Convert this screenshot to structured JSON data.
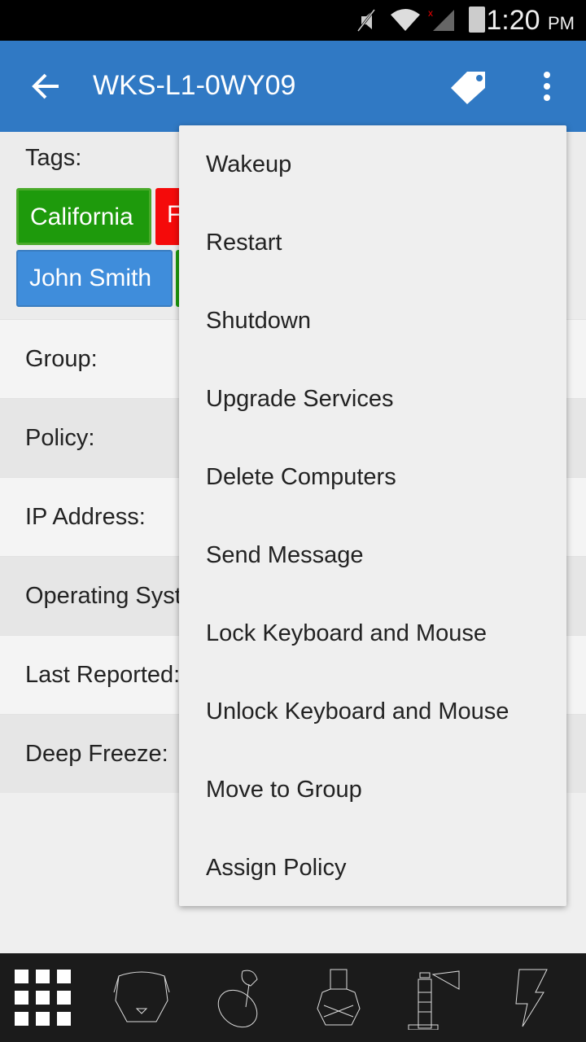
{
  "status_bar": {
    "time": "1:20",
    "ampm": "PM"
  },
  "app_bar": {
    "title": "WKS-L1-0WY09"
  },
  "tags": {
    "label": "Tags:",
    "items": [
      {
        "label": "California",
        "color": "#1e9a0c"
      },
      {
        "label": "F",
        "color": "#f50a0a"
      },
      {
        "label": "John Smith",
        "color": "#3f8ddb"
      },
      {
        "label": "",
        "color": "#1e9a0c"
      }
    ]
  },
  "fields": [
    {
      "label": "Group:"
    },
    {
      "label": "Policy:"
    },
    {
      "label": "IP Address:"
    },
    {
      "label": "Operating System:"
    },
    {
      "label": "Last Reported:"
    },
    {
      "label": "Deep Freeze:"
    }
  ],
  "menu": {
    "items": [
      "Wakeup",
      "Restart",
      "Shutdown",
      "Upgrade Services",
      "Delete Computers",
      "Send Message",
      "Lock Keyboard and Mouse",
      "Unlock Keyboard and Mouse",
      "Move to Group",
      "Assign Policy"
    ]
  },
  "bottom_nav": {
    "icons": [
      "grid-icon",
      "bear-icon",
      "joystick-icon",
      "bouncer-icon",
      "lighthouse-icon",
      "lightning-icon"
    ]
  },
  "colors": {
    "app_bar": "#3079c4"
  }
}
